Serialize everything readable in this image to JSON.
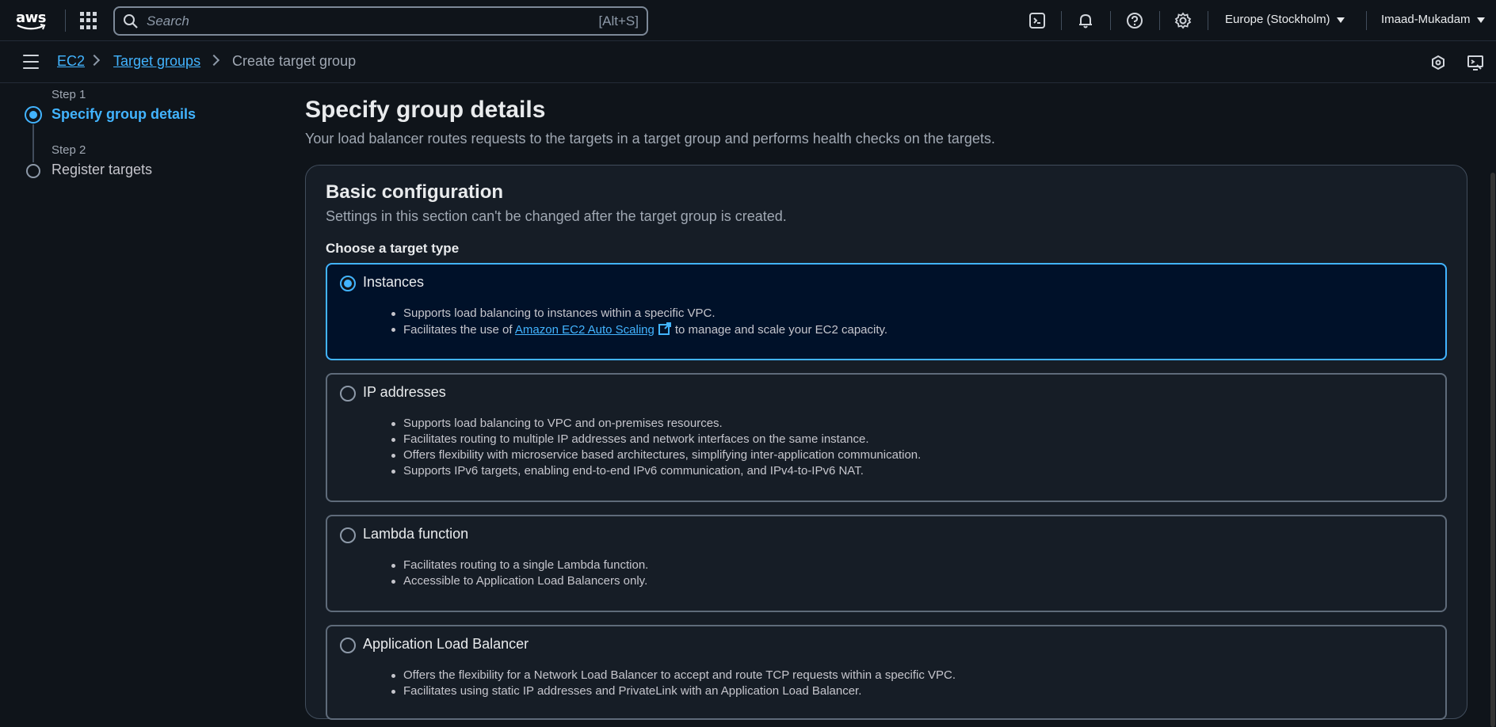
{
  "header": {
    "logo_text": "aws",
    "search": {
      "placeholder": "Search",
      "shortcut": "[Alt+S]"
    },
    "region": "Europe (Stockholm)",
    "user": "Imaad-Mukadam",
    "icons": [
      "cloudshell-icon",
      "bell-icon",
      "help-icon",
      "gear-icon"
    ]
  },
  "breadcrumb": {
    "items": [
      {
        "label": "EC2",
        "link": true
      },
      {
        "label": "Target groups",
        "link": true
      },
      {
        "label": "Create target group",
        "link": false
      }
    ]
  },
  "steps": [
    {
      "step": "Step 1",
      "title": "Specify group details",
      "active": true
    },
    {
      "step": "Step 2",
      "title": "Register targets",
      "active": false
    }
  ],
  "main": {
    "title": "Specify group details",
    "description": "Your load balancer routes requests to the targets in a target group and performs health checks on the targets."
  },
  "basic_configuration": {
    "title": "Basic configuration",
    "description": "Settings in this section can't be changed after the target group is created.",
    "field_label": "Choose a target type",
    "options": [
      {
        "label": "Instances",
        "selected": true,
        "bullets": [
          "Supports load balancing to instances within a specific VPC.",
          "Facilitates the use of"
        ],
        "link_text": "Amazon EC2 Auto Scaling",
        "link_suffix": "to manage and scale your EC2 capacity."
      },
      {
        "label": "IP addresses",
        "selected": false,
        "bullets": [
          "Supports load balancing to VPC and on-premises resources.",
          "Facilitates routing to multiple IP addresses and network interfaces on the same instance.",
          "Offers flexibility with microservice based architectures, simplifying inter-application communication.",
          "Supports IPv6 targets, enabling end-to-end IPv6 communication, and IPv4-to-IPv6 NAT."
        ]
      },
      {
        "label": "Lambda function",
        "selected": false,
        "bullets": [
          "Facilitates routing to a single Lambda function.",
          "Accessible to Application Load Balancers only."
        ]
      },
      {
        "label": "Application Load Balancer",
        "selected": false,
        "bullets": [
          "Offers the flexibility for a Network Load Balancer to accept and route TCP requests within a specific VPC.",
          "Facilitates using static IP addresses and PrivateLink with an Application Load Balancer."
        ]
      }
    ]
  },
  "colors": {
    "accent": "#42b4ff",
    "background": "#0f141a",
    "panel": "#161d26"
  }
}
